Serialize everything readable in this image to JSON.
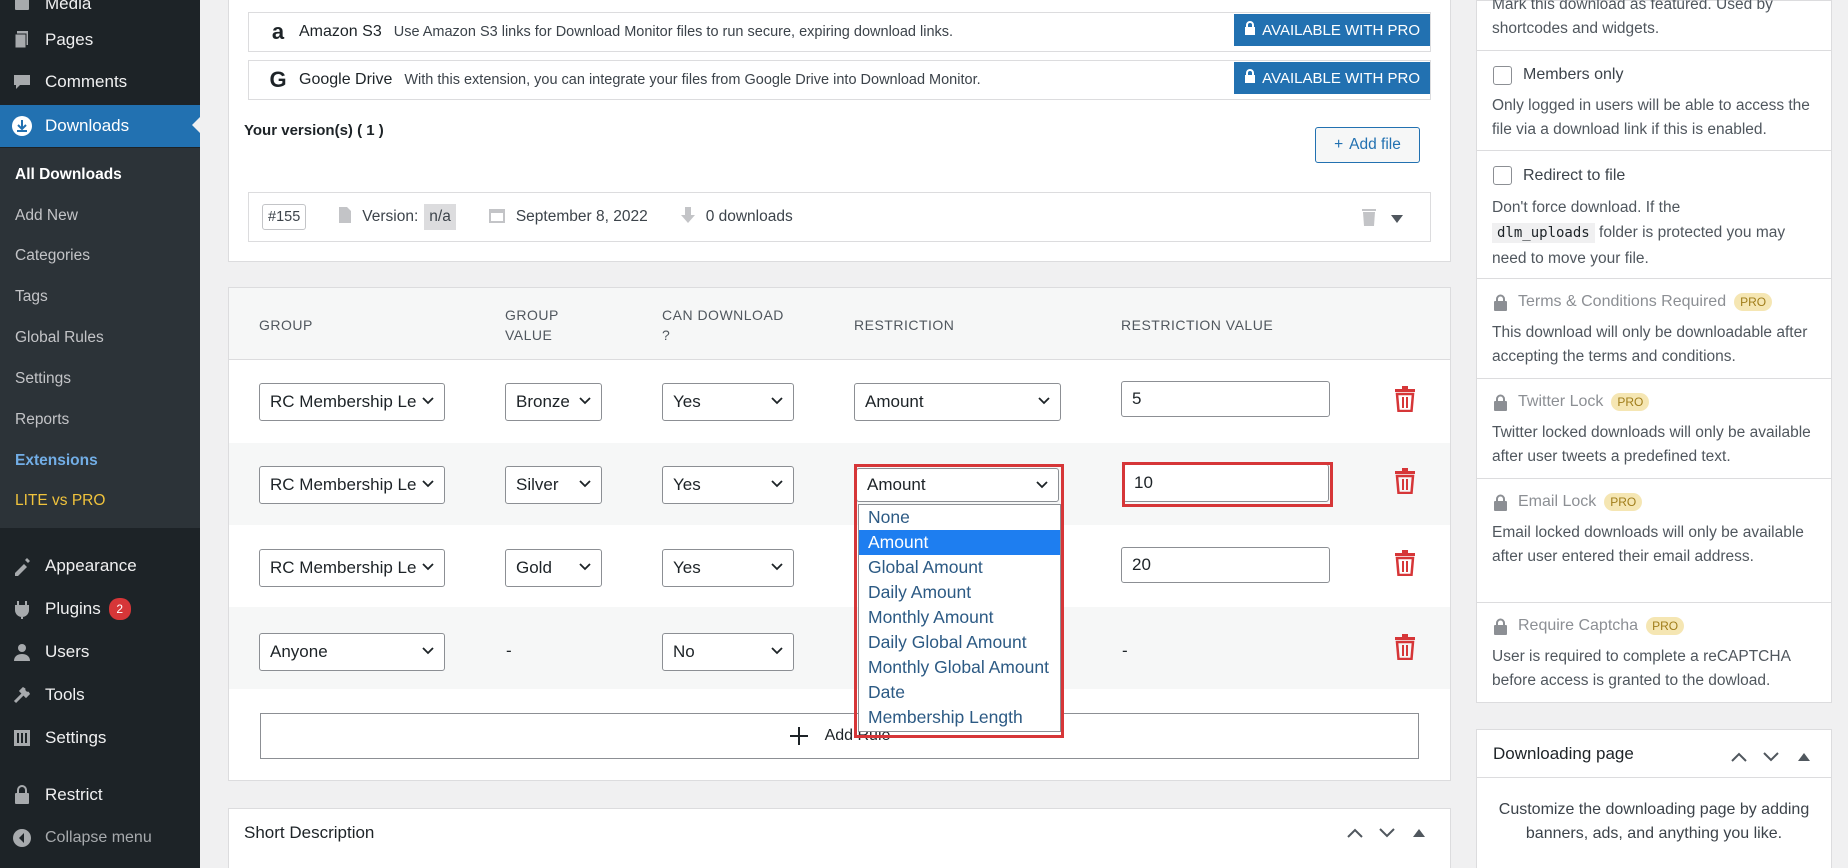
{
  "sidebar": {
    "top_items": [
      {
        "label": "Media",
        "icon": "media-icon"
      },
      {
        "label": "Pages",
        "icon": "pages-icon"
      },
      {
        "label": "Comments",
        "icon": "comments-icon"
      },
      {
        "label": "Downloads",
        "icon": "download-icon"
      }
    ],
    "submenu": [
      "All Downloads",
      "Add New",
      "Categories",
      "Tags",
      "Global Rules",
      "Settings",
      "Reports",
      "Extensions",
      "LITE vs PRO"
    ],
    "bottom_items": [
      {
        "label": "Appearance",
        "icon": "appearance-icon"
      },
      {
        "label": "Plugins",
        "icon": "plugins-icon",
        "badge": "2"
      },
      {
        "label": "Users",
        "icon": "users-icon"
      },
      {
        "label": "Tools",
        "icon": "tools-icon"
      },
      {
        "label": "Settings",
        "icon": "settings-icon"
      },
      {
        "label": "Restrict",
        "icon": "lock-icon"
      }
    ],
    "collapse_label": "Collapse menu"
  },
  "extensions": [
    {
      "logo": "a",
      "name": "Amazon S3",
      "desc": "Use Amazon S3 links for Download Monitor files to run secure, expiring download links.",
      "button": "AVAILABLE WITH PRO"
    },
    {
      "logo": "G",
      "name": "Google Drive",
      "desc": "With this extension, you can integrate your files from Google Drive into Download Monitor.",
      "button": "AVAILABLE WITH PRO"
    }
  ],
  "versions": {
    "title": "Your version(s) ( 1 )",
    "add_file": "Add file",
    "row": {
      "id": "#155",
      "version_label": "Version:",
      "version": "n/a",
      "date": "September 8, 2022",
      "downloads": "0 downloads"
    }
  },
  "rules": {
    "headers": {
      "group": "GROUP",
      "group_value_1": "GROUP",
      "group_value_2": "VALUE",
      "can_download_1": "CAN DOWNLOAD",
      "can_download_2": "?",
      "restriction": "RESTRICTION",
      "restriction_value": "RESTRICTION VALUE"
    },
    "rows": [
      {
        "group": "RC Membership Le",
        "group_value": "Bronze",
        "can_download": "Yes",
        "restriction": "Amount",
        "restriction_value": "5"
      },
      {
        "group": "RC Membership Le",
        "group_value": "Silver",
        "can_download": "Yes",
        "restriction": "Amount",
        "restriction_value": "10"
      },
      {
        "group": "RC Membership Le",
        "group_value": "Gold",
        "can_download": "Yes",
        "restriction": "",
        "restriction_value": "20"
      },
      {
        "group": "Anyone",
        "group_value": "-",
        "can_download": "No",
        "restriction": "",
        "restriction_value": "-"
      }
    ],
    "dropdown_options": [
      "None",
      "Amount",
      "Global Amount",
      "Daily Amount",
      "Monthly Amount",
      "Daily Global Amount",
      "Monthly Global Amount",
      "Date",
      "Membership Length"
    ],
    "dropdown_selected": "Amount",
    "add_rule": "Add Rule"
  },
  "short_description": {
    "title": "Short Description"
  },
  "right_panel": {
    "featured_text": "Mark this download as featured. Used by shortcodes and widgets.",
    "members_only": {
      "label": "Members only",
      "desc": "Only logged in users will be able to access the file via a download link if this is enabled."
    },
    "redirect": {
      "label": "Redirect to file",
      "desc_1": "Don't force download. If the",
      "code": "dlm_uploads",
      "desc_2": "folder is protected you may need to move your file."
    },
    "pro_features": [
      {
        "label": "Terms & Conditions Required",
        "tag": "PRO",
        "desc": "This download will only be downloadable after accepting the terms and conditions."
      },
      {
        "label": "Twitter Lock",
        "tag": "PRO",
        "desc": "Twitter locked downloads will only be available after user tweets a predefined text."
      },
      {
        "label": "Email Lock",
        "tag": "PRO",
        "desc": "Email locked downloads will only be available after user entered their email address."
      },
      {
        "label": "Require Captcha",
        "tag": "PRO",
        "desc": "User is required to complete a reCAPTCHA before access is granted to the dowload."
      }
    ]
  },
  "downloading_page": {
    "title": "Downloading page",
    "desc": "Customize the downloading page by adding banners, ads, and anything you like."
  },
  "colors": {
    "accent": "#2271b1",
    "danger": "#d63638",
    "sidebar": "#1d2327",
    "highlight": "#1e7ef0"
  }
}
